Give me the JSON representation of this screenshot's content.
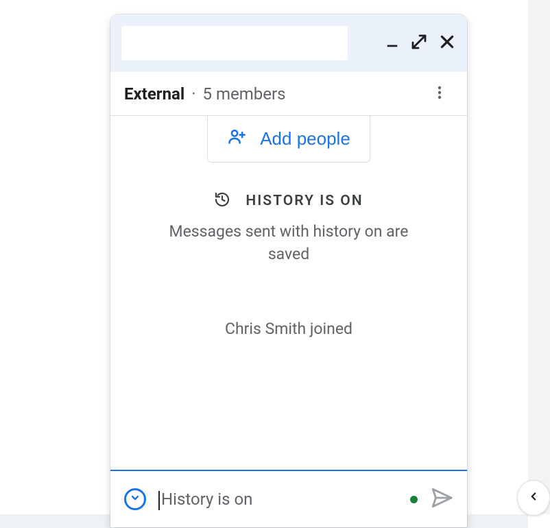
{
  "subheader": {
    "badge": "External",
    "separator": "·",
    "members": "5 members"
  },
  "add_people": {
    "label": "Add people"
  },
  "history": {
    "title": "HISTORY IS ON",
    "description": "Messages sent with history on are saved"
  },
  "system_message": "Chris Smith joined",
  "compose": {
    "placeholder": "History is on"
  }
}
